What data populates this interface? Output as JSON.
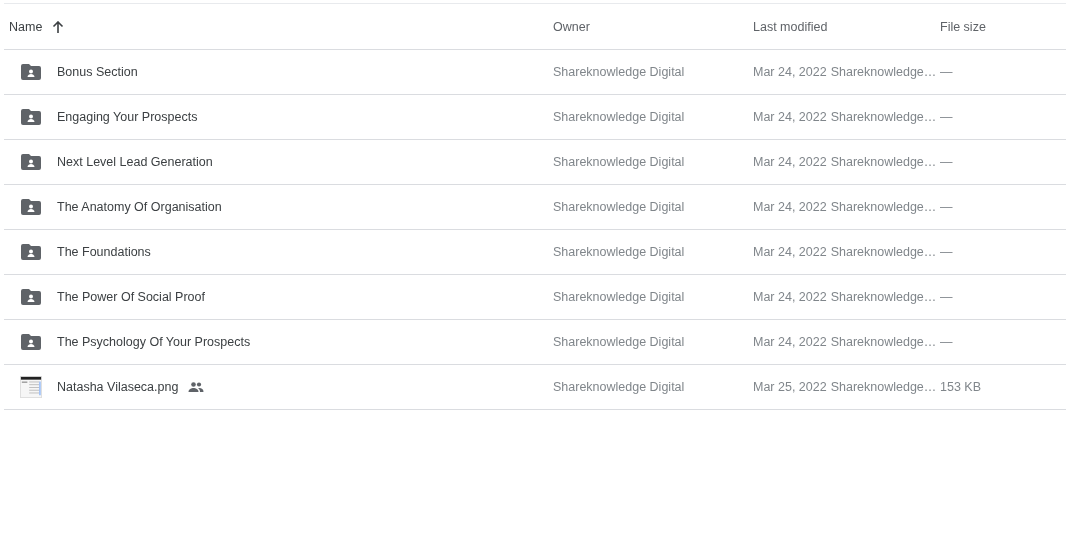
{
  "table": {
    "columns": [
      {
        "label": "Name",
        "sorted_ascending": true
      },
      {
        "label": "Owner"
      },
      {
        "label": "Last modified"
      },
      {
        "label": "File size"
      }
    ],
    "rows": [
      {
        "kind": "folder",
        "name": "Bonus Section",
        "shared": false,
        "owner": "Shareknowledge Digital",
        "date": "Mar 24, 2022",
        "modified_by": "Shareknowledge…",
        "size": "—"
      },
      {
        "kind": "folder",
        "name": "Engaging Your Prospects",
        "shared": false,
        "owner": "Shareknowledge Digital",
        "date": "Mar 24, 2022",
        "modified_by": "Shareknowledge…",
        "size": "—"
      },
      {
        "kind": "folder",
        "name": "Next Level Lead Generation",
        "shared": false,
        "owner": "Shareknowledge Digital",
        "date": "Mar 24, 2022",
        "modified_by": "Shareknowledge…",
        "size": "—"
      },
      {
        "kind": "folder",
        "name": "The Anatomy Of Organisation",
        "shared": false,
        "owner": "Shareknowledge Digital",
        "date": "Mar 24, 2022",
        "modified_by": "Shareknowledge…",
        "size": "—"
      },
      {
        "kind": "folder",
        "name": "The Foundations",
        "shared": false,
        "owner": "Shareknowledge Digital",
        "date": "Mar 24, 2022",
        "modified_by": "Shareknowledge…",
        "size": "—"
      },
      {
        "kind": "folder",
        "name": "The Power Of Social Proof",
        "shared": false,
        "owner": "Shareknowledge Digital",
        "date": "Mar 24, 2022",
        "modified_by": "Shareknowledge…",
        "size": "—"
      },
      {
        "kind": "folder",
        "name": "The Psychology Of Your Prospects",
        "shared": false,
        "owner": "Shareknowledge Digital",
        "date": "Mar 24, 2022",
        "modified_by": "Shareknowledge…",
        "size": "—"
      },
      {
        "kind": "image",
        "name": "Natasha Vilaseca.png",
        "shared": true,
        "owner": "Shareknowledge Digital",
        "date": "Mar 25, 2022",
        "modified_by": "Shareknowledge…",
        "size": "153 KB"
      }
    ]
  }
}
